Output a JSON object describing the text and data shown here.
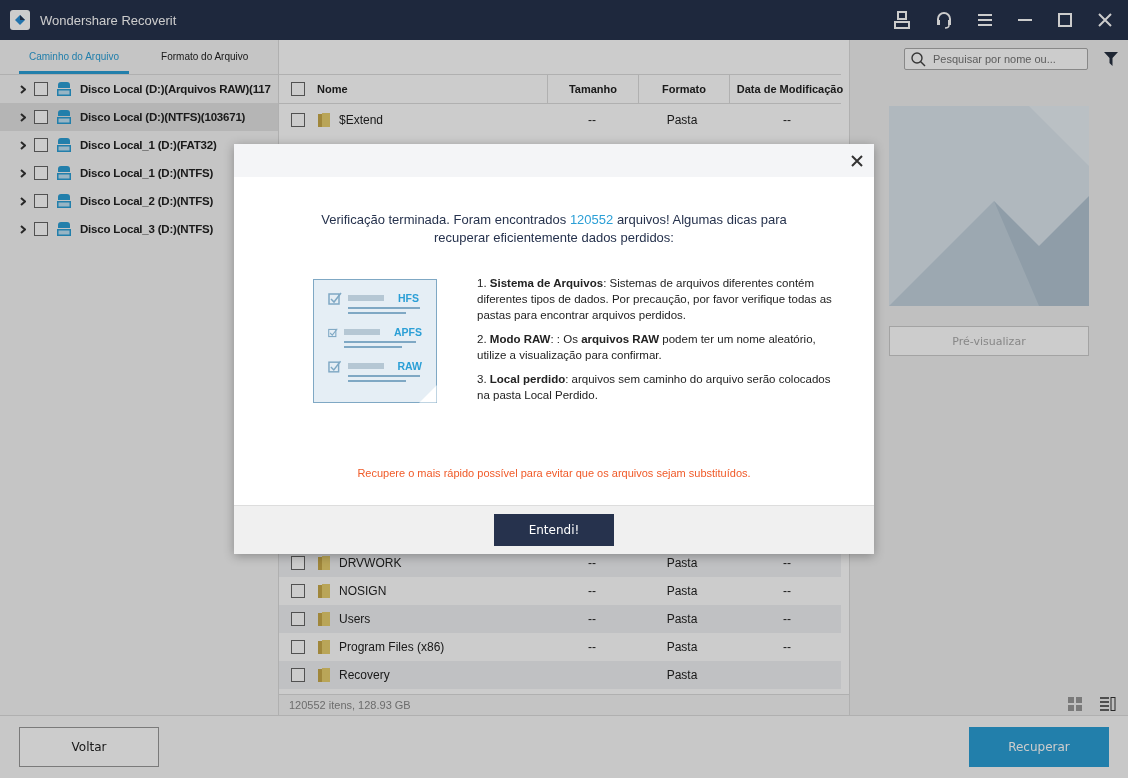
{
  "window": {
    "title": "Wondershare Recoverit"
  },
  "sidebar": {
    "tabs": [
      {
        "label": "Caminho do Arquivo",
        "selected": true
      },
      {
        "label": "Formato do Arquivo",
        "selected": false
      }
    ],
    "items": [
      {
        "label": "Disco Local (D:)(Arquivos RAW)(117",
        "selected": false,
        "checked": false
      },
      {
        "label": "Disco Local (D:)(NTFS)(103671)",
        "selected": true,
        "checked": false
      },
      {
        "label": "Disco Local_1 (D:)(FAT32)",
        "selected": false,
        "checked": false
      },
      {
        "label": "Disco Local_1 (D:)(NTFS)",
        "selected": false,
        "checked": false
      },
      {
        "label": "Disco Local_2 (D:)(NTFS)",
        "selected": false,
        "checked": false
      },
      {
        "label": "Disco Local_3 (D:)(NTFS)",
        "selected": false,
        "checked": false
      }
    ]
  },
  "search": {
    "placeholder": "Pesquisar por nome ou..."
  },
  "table": {
    "all_checked": false,
    "columns": [
      "Nome",
      "Tamanho",
      "Formato",
      "Data de Modificação"
    ],
    "rows": [
      {
        "name": "$Extend",
        "size": "--",
        "format": "Pasta",
        "modified": "--",
        "checked": false
      },
      {
        "name": "DRVWORK",
        "size": "--",
        "format": "Pasta",
        "modified": "--",
        "checked": false
      },
      {
        "name": "NOSIGN",
        "size": "--",
        "format": "Pasta",
        "modified": "--",
        "checked": false
      },
      {
        "name": "Users",
        "size": "--",
        "format": "Pasta",
        "modified": "--",
        "checked": false
      },
      {
        "name": "Program Files (x86)",
        "size": "--",
        "format": "Pasta",
        "modified": "--",
        "checked": false
      },
      {
        "name": "Recovery",
        "format": "Pasta",
        "checked": false
      }
    ]
  },
  "status_bar": "120552 itens, 128.93 GB",
  "preview_button": {
    "label": "Pré-visualizar",
    "disabled": true
  },
  "buttons": {
    "back": "Voltar",
    "recover": "Recuperar"
  },
  "dialog": {
    "headline_before": "Verificação terminada. Foram encontrados",
    "count": "120552",
    "headline_after": "arquivos! Algumas dicas para recuperar eficientemente dados perdidos:",
    "illustration_labels": [
      "HFS",
      "APFS",
      "RAW"
    ],
    "tips": [
      "1. **Sistema de Arquivos**: Sistemas de arquivos diferentes contém diferentes tipos de dados. Por precaução, por favor verifique todas as pastas para encontrar arquivos perdidos.",
      "2. **Modo RAW**:  : Os **arquivos RAW** podem ter um nome aleatório, utilize a visualização para confirmar.",
      "3. **Local perdido**: arquivos sem caminho do arquivo serão colocados na pasta Local Perdido."
    ],
    "warning": "Recupere o mais rápido possível para evitar que os arquivos sejam substituídos.",
    "button": "Entendi!"
  }
}
